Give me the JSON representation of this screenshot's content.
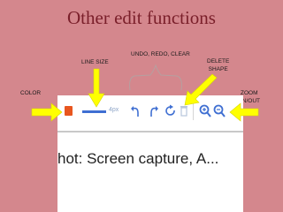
{
  "title": "Other edit functions",
  "labels": {
    "line_size": "LINE SIZE",
    "undo_redo_clear": "UNDO, REDO, CLEAR",
    "delete_shape_1": "DELETE",
    "delete_shape_2": "SHAPE",
    "color": "COLOR",
    "zoom_1": "ZOOM",
    "zoom_2": "IN/OUT"
  },
  "toolbar": {
    "size_text": "4px",
    "icons": [
      "color-swatch",
      "line-size",
      "undo-icon",
      "redo-icon",
      "refresh-icon",
      "trash-icon",
      "zoom-in-icon",
      "zoom-out-icon"
    ]
  },
  "caption": "hot: Screen capture, A...",
  "colors": {
    "background": "#d4878d",
    "title": "#7a1f2a",
    "arrow": "#ffff00",
    "swatch": "#e8561f",
    "toolbar_blue": "#3f6fd2"
  }
}
